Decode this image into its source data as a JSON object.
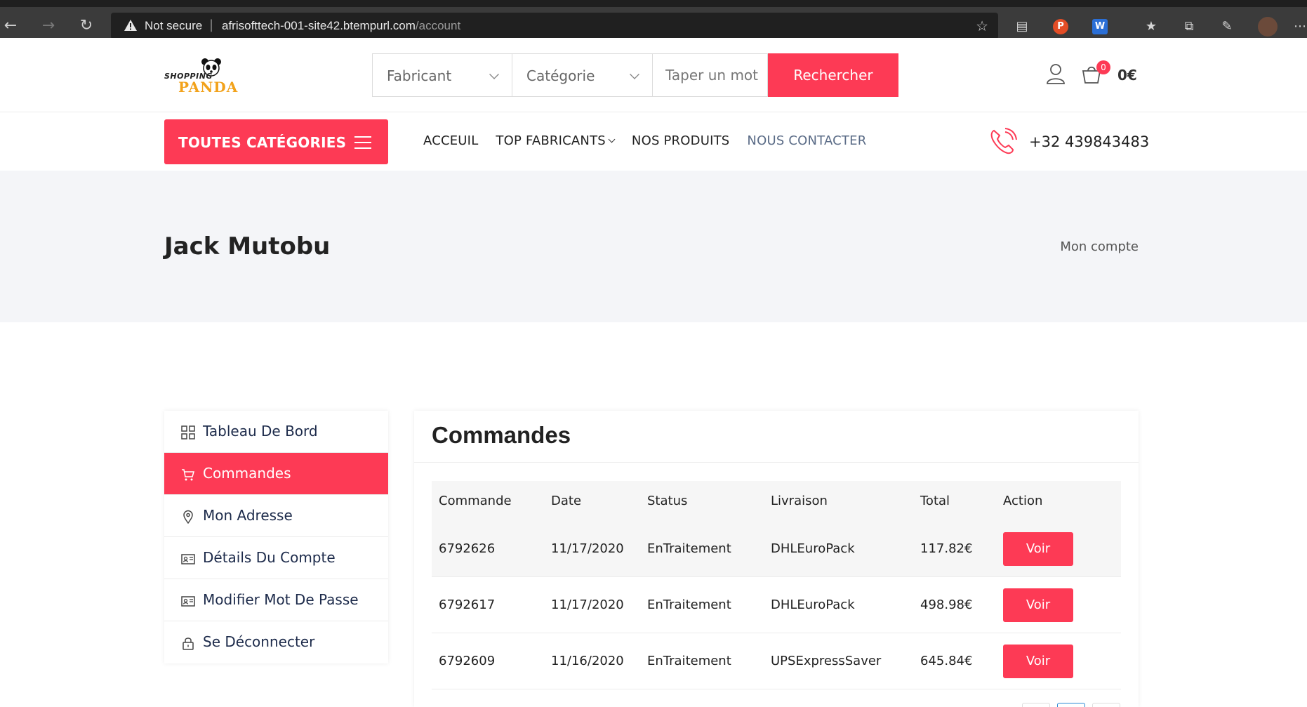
{
  "browser": {
    "not_secure": "Not secure",
    "url_host": "afrisofttech-001-site42.btempurl.com",
    "url_path": "/account",
    "ext_p": "P",
    "ext_w": "W"
  },
  "header": {
    "logo_top": "SHOPPING",
    "logo_bottom": "PANDA",
    "manufacturer_select": "Fabricant",
    "category_select": "Catégorie",
    "search_placeholder": "Taper un mot",
    "search_button": "Rechercher",
    "cart_count": "0",
    "cart_total": "0€"
  },
  "nav": {
    "all_categories": "TOUTES CATÉGORIES",
    "items": [
      {
        "label": "ACCEUIL"
      },
      {
        "label": "TOP FABRICANTS"
      },
      {
        "label": "NOS PRODUITS"
      },
      {
        "label": "NOUS CONTACTER"
      }
    ],
    "phone": "+32 439843483"
  },
  "banner": {
    "title": "Jack Mutobu",
    "breadcrumb": "Mon compte"
  },
  "sidebar": {
    "items": [
      {
        "label": "Tableau De Bord",
        "icon": "grid-icon"
      },
      {
        "label": "Commandes",
        "icon": "cart-icon",
        "active": true
      },
      {
        "label": "Mon Adresse",
        "icon": "location-pin-icon"
      },
      {
        "label": "Détails Du Compte",
        "icon": "id-card-icon"
      },
      {
        "label": "Modifier Mot De Passe",
        "icon": "id-card-icon"
      },
      {
        "label": "Se Déconnecter",
        "icon": "lock-icon"
      }
    ]
  },
  "orders": {
    "title": "Commandes",
    "columns": [
      "Commande",
      "Date",
      "Status",
      "Livraison",
      "Total",
      "Action"
    ],
    "rows": [
      {
        "id": "6792626",
        "date": "11/17/2020",
        "status": "EnTraitement",
        "delivery": "DHLEuroPack",
        "total": "117.82€",
        "action": "Voir"
      },
      {
        "id": "6792617",
        "date": "11/17/2020",
        "status": "EnTraitement",
        "delivery": "DHLEuroPack",
        "total": "498.98€",
        "action": "Voir"
      },
      {
        "id": "6792609",
        "date": "11/16/2020",
        "status": "EnTraitement",
        "delivery": "UPSExpressSaver",
        "total": "645.84€",
        "action": "Voir"
      }
    ]
  },
  "colors": {
    "accent": "#fd3a55",
    "banner_bg": "#f4f5f8",
    "browser_bg": "#3b3b3b"
  }
}
